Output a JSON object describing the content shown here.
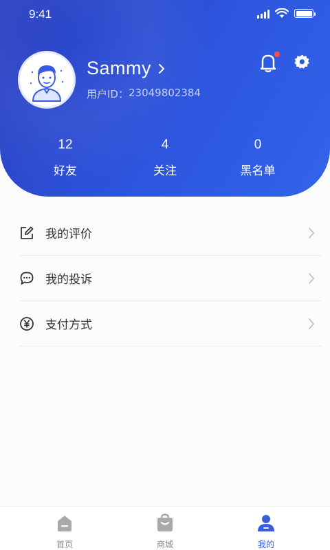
{
  "status_bar": {
    "time": "9:41"
  },
  "profile": {
    "username": "Sammy",
    "user_id_label": "用户ID：",
    "user_id_value": "23049802384"
  },
  "stats": [
    {
      "value": "12",
      "label": "好友"
    },
    {
      "value": "4",
      "label": "关注"
    },
    {
      "value": "0",
      "label": "黑名单"
    }
  ],
  "menu": [
    {
      "label": "我的评价",
      "icon": "edit-icon"
    },
    {
      "label": "我的投诉",
      "icon": "chat-icon"
    },
    {
      "label": "支付方式",
      "icon": "yuan-icon"
    }
  ],
  "tabbar": [
    {
      "label": "首页",
      "icon": "home-icon",
      "active": false
    },
    {
      "label": "商城",
      "icon": "shop-icon",
      "active": false
    },
    {
      "label": "我的",
      "icon": "profile-icon",
      "active": true
    }
  ],
  "colors": {
    "accent": "#3a5be0",
    "header_gradient_start": "#2a3fc0",
    "header_gradient_end": "#3264ea",
    "notification_dot": "#ff4d4d"
  }
}
